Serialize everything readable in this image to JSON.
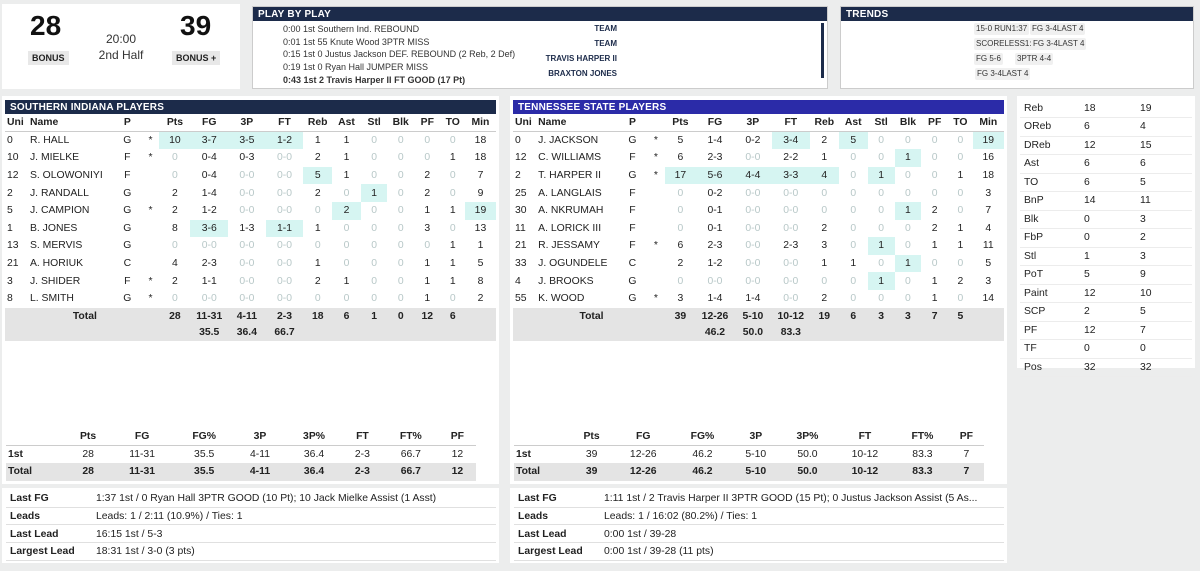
{
  "score": {
    "home_score": "28",
    "away_score": "39",
    "clock": "20:00",
    "period": "2nd Half",
    "home_bonus": "BONUS",
    "away_bonus": "BONUS  +"
  },
  "pbp": {
    "title": "PLAY BY PLAY",
    "events": [
      "0:00 1st Southern Ind. REBOUND",
      "0:01 1st 55 Knute Wood 3PTR MISS",
      "0:15 1st 0 Justus Jackson DEF. REBOUND (2 Reb, 2 Def)",
      "0:19 1st 0 Ryan Hall JUMPER MISS",
      "0:43 1st 2 Travis Harper II FT GOOD (17 Pt)"
    ]
  },
  "trends": {
    "title": "TRENDS",
    "rows": [
      {
        "label": "TEAM",
        "chips": [
          "15-0 RUN1:37",
          "FG 3-4LAST 4"
        ]
      },
      {
        "label": "TEAM",
        "chips": [
          "SCORELESS1:37",
          "FG 3-4LAST 4"
        ]
      },
      {
        "label": "TRAVIS HARPER II",
        "chips": [
          "FG 5-6",
          "3PTR 4-4"
        ]
      },
      {
        "label": "BRAXTON JONES",
        "chips": [
          "FG 3-4LAST 4"
        ]
      }
    ]
  },
  "home": {
    "title": "SOUTHERN INDIANA PLAYERS",
    "players": [
      {
        "uni": "0",
        "name": "R. HALL",
        "p": "G",
        "s": "*",
        "pts": "10",
        "fg": "3-7",
        "tp": "3-5",
        "ft": "1-2",
        "reb": "1",
        "ast": "1",
        "stl": "0",
        "blk": "0",
        "pf": "0",
        "to": "0",
        "min": "18"
      },
      {
        "uni": "10",
        "name": "J. MIELKE",
        "p": "F",
        "s": "*",
        "pts": "0",
        "fg": "0-4",
        "tp": "0-3",
        "ft": "0-0",
        "reb": "2",
        "ast": "1",
        "stl": "0",
        "blk": "0",
        "pf": "0",
        "to": "1",
        "min": "18"
      },
      {
        "uni": "12",
        "name": "S. OLOWONIYI",
        "p": "F",
        "s": "",
        "pts": "0",
        "fg": "0-4",
        "tp": "0-0",
        "ft": "0-0",
        "reb": "5",
        "ast": "1",
        "stl": "0",
        "blk": "0",
        "pf": "2",
        "to": "0",
        "min": "7"
      },
      {
        "uni": "2",
        "name": "J. RANDALL",
        "p": "G",
        "s": "",
        "pts": "2",
        "fg": "1-4",
        "tp": "0-0",
        "ft": "0-0",
        "reb": "2",
        "ast": "0",
        "stl": "1",
        "blk": "0",
        "pf": "2",
        "to": "0",
        "min": "9"
      },
      {
        "uni": "5",
        "name": "J. CAMPION",
        "p": "G",
        "s": "*",
        "pts": "2",
        "fg": "1-2",
        "tp": "0-0",
        "ft": "0-0",
        "reb": "0",
        "ast": "2",
        "stl": "0",
        "blk": "0",
        "pf": "1",
        "to": "1",
        "min": "19"
      },
      {
        "uni": "1",
        "name": "B. JONES",
        "p": "G",
        "s": "",
        "pts": "8",
        "fg": "3-6",
        "tp": "1-3",
        "ft": "1-1",
        "reb": "1",
        "ast": "0",
        "stl": "0",
        "blk": "0",
        "pf": "3",
        "to": "0",
        "min": "13"
      },
      {
        "uni": "13",
        "name": "S. MERVIS",
        "p": "G",
        "s": "",
        "pts": "0",
        "fg": "0-0",
        "tp": "0-0",
        "ft": "0-0",
        "reb": "0",
        "ast": "0",
        "stl": "0",
        "blk": "0",
        "pf": "0",
        "to": "1",
        "min": "1"
      },
      {
        "uni": "21",
        "name": "A. HORIUK",
        "p": "C",
        "s": "",
        "pts": "4",
        "fg": "2-3",
        "tp": "0-0",
        "ft": "0-0",
        "reb": "1",
        "ast": "0",
        "stl": "0",
        "blk": "0",
        "pf": "1",
        "to": "1",
        "min": "5"
      },
      {
        "uni": "3",
        "name": "J. SHIDER",
        "p": "F",
        "s": "*",
        "pts": "2",
        "fg": "1-1",
        "tp": "0-0",
        "ft": "0-0",
        "reb": "2",
        "ast": "1",
        "stl": "0",
        "blk": "0",
        "pf": "1",
        "to": "1",
        "min": "8"
      },
      {
        "uni": "8",
        "name": "L. SMITH",
        "p": "G",
        "s": "*",
        "pts": "0",
        "fg": "0-0",
        "tp": "0-0",
        "ft": "0-0",
        "reb": "0",
        "ast": "0",
        "stl": "0",
        "blk": "0",
        "pf": "1",
        "to": "0",
        "min": "2"
      }
    ],
    "total": {
      "label": "Total",
      "pts": "28",
      "fg": "11-31",
      "tp": "4-11",
      "ft": "2-3",
      "reb": "18",
      "ast": "6",
      "stl": "1",
      "blk": "0",
      "pf": "12",
      "to": "6"
    },
    "pct": {
      "fg": "35.5",
      "tp": "36.4",
      "ft": "66.7"
    },
    "halves": [
      {
        "label": "1st",
        "pts": "28",
        "fg": "11-31",
        "fgp": "35.5",
        "tp": "4-11",
        "tpp": "36.4",
        "ft": "2-3",
        "ftp": "66.7",
        "pf": "12"
      },
      {
        "label": "Total",
        "pts": "28",
        "fg": "11-31",
        "fgp": "35.5",
        "tp": "4-11",
        "tpp": "36.4",
        "ft": "2-3",
        "ftp": "66.7",
        "pf": "12"
      }
    ],
    "info": [
      {
        "k": "Last FG",
        "v": "1:37 1st / 0 Ryan Hall 3PTR GOOD (10 Pt); 10 Jack Mielke Assist (1 Asst)"
      },
      {
        "k": "Leads",
        "v": "Leads: 1 / 2:11 (10.9%) / Ties: 1"
      },
      {
        "k": "Last Lead",
        "v": "16:15 1st / 5-3"
      },
      {
        "k": "Largest Lead",
        "v": "18:31 1st / 3-0 (3 pts)"
      }
    ]
  },
  "away": {
    "title": "TENNESSEE STATE PLAYERS",
    "players": [
      {
        "uni": "0",
        "name": "J. JACKSON",
        "p": "G",
        "s": "*",
        "pts": "5",
        "fg": "1-4",
        "tp": "0-2",
        "ft": "3-4",
        "reb": "2",
        "ast": "5",
        "stl": "0",
        "blk": "0",
        "pf": "0",
        "to": "0",
        "min": "19"
      },
      {
        "uni": "12",
        "name": "C. WILLIAMS",
        "p": "F",
        "s": "*",
        "pts": "6",
        "fg": "2-3",
        "tp": "0-0",
        "ft": "2-2",
        "reb": "1",
        "ast": "0",
        "stl": "0",
        "blk": "1",
        "pf": "0",
        "to": "0",
        "min": "16"
      },
      {
        "uni": "2",
        "name": "T. HARPER II",
        "p": "G",
        "s": "*",
        "pts": "17",
        "fg": "5-6",
        "tp": "4-4",
        "ft": "3-3",
        "reb": "4",
        "ast": "0",
        "stl": "1",
        "blk": "0",
        "pf": "0",
        "to": "1",
        "min": "18"
      },
      {
        "uni": "25",
        "name": "A. LANGLAIS",
        "p": "F",
        "s": "",
        "pts": "0",
        "fg": "0-2",
        "tp": "0-0",
        "ft": "0-0",
        "reb": "0",
        "ast": "0",
        "stl": "0",
        "blk": "0",
        "pf": "0",
        "to": "0",
        "min": "3"
      },
      {
        "uni": "30",
        "name": "A. NKRUMAH",
        "p": "F",
        "s": "",
        "pts": "0",
        "fg": "0-1",
        "tp": "0-0",
        "ft": "0-0",
        "reb": "0",
        "ast": "0",
        "stl": "0",
        "blk": "1",
        "pf": "2",
        "to": "0",
        "min": "7"
      },
      {
        "uni": "11",
        "name": "A. LORICK III",
        "p": "F",
        "s": "",
        "pts": "0",
        "fg": "0-1",
        "tp": "0-0",
        "ft": "0-0",
        "reb": "2",
        "ast": "0",
        "stl": "0",
        "blk": "0",
        "pf": "2",
        "to": "1",
        "min": "4"
      },
      {
        "uni": "21",
        "name": "R. JESSAMY",
        "p": "F",
        "s": "*",
        "pts": "6",
        "fg": "2-3",
        "tp": "0-0",
        "ft": "2-3",
        "reb": "3",
        "ast": "0",
        "stl": "1",
        "blk": "0",
        "pf": "1",
        "to": "1",
        "min": "11"
      },
      {
        "uni": "33",
        "name": "J. OGUNDELE",
        "p": "C",
        "s": "",
        "pts": "2",
        "fg": "1-2",
        "tp": "0-0",
        "ft": "0-0",
        "reb": "1",
        "ast": "1",
        "stl": "0",
        "blk": "1",
        "pf": "0",
        "to": "0",
        "min": "5"
      },
      {
        "uni": "4",
        "name": "J. BROOKS",
        "p": "G",
        "s": "",
        "pts": "0",
        "fg": "0-0",
        "tp": "0-0",
        "ft": "0-0",
        "reb": "0",
        "ast": "0",
        "stl": "1",
        "blk": "0",
        "pf": "1",
        "to": "2",
        "min": "3"
      },
      {
        "uni": "55",
        "name": "K. WOOD",
        "p": "G",
        "s": "*",
        "pts": "3",
        "fg": "1-4",
        "tp": "1-4",
        "ft": "0-0",
        "reb": "2",
        "ast": "0",
        "stl": "0",
        "blk": "0",
        "pf": "1",
        "to": "0",
        "min": "14"
      }
    ],
    "total": {
      "label": "Total",
      "pts": "39",
      "fg": "12-26",
      "tp": "5-10",
      "ft": "10-12",
      "reb": "19",
      "ast": "6",
      "stl": "3",
      "blk": "3",
      "pf": "7",
      "to": "5"
    },
    "pct": {
      "fg": "46.2",
      "tp": "50.0",
      "ft": "83.3"
    },
    "halves": [
      {
        "label": "1st",
        "pts": "39",
        "fg": "12-26",
        "fgp": "46.2",
        "tp": "5-10",
        "tpp": "50.0",
        "ft": "10-12",
        "ftp": "83.3",
        "pf": "7"
      },
      {
        "label": "Total",
        "pts": "39",
        "fg": "12-26",
        "fgp": "46.2",
        "tp": "5-10",
        "tpp": "50.0",
        "ft": "10-12",
        "ftp": "83.3",
        "pf": "7"
      }
    ],
    "info": [
      {
        "k": "Last FG",
        "v": "1:11 1st / 2 Travis Harper II 3PTR GOOD (15 Pt); 0 Justus Jackson Assist (5 As..."
      },
      {
        "k": "Leads",
        "v": "Leads: 1 / 16:02 (80.2%) / Ties: 1"
      },
      {
        "k": "Last Lead",
        "v": "0:00 1st / 39-28"
      },
      {
        "k": "Largest Lead",
        "v": "0:00 1st / 39-28 (11 pts)"
      }
    ]
  },
  "box_headers": [
    "Uni",
    "Name",
    "P",
    "",
    "Pts",
    "FG",
    "3P",
    "FT",
    "Reb",
    "Ast",
    "Stl",
    "Blk",
    "PF",
    "TO",
    "Min"
  ],
  "half_headers": [
    "",
    "Pts",
    "FG",
    "FG%",
    "3P",
    "3P%",
    "FT",
    "FT%",
    "PF"
  ],
  "team_stats": [
    {
      "k": "Reb",
      "h": "18",
      "a": "19"
    },
    {
      "k": "OReb",
      "h": "6",
      "a": "4"
    },
    {
      "k": "DReb",
      "h": "12",
      "a": "15"
    },
    {
      "k": "Ast",
      "h": "6",
      "a": "6"
    },
    {
      "k": "TO",
      "h": "6",
      "a": "5"
    },
    {
      "k": "BnP",
      "h": "14",
      "a": "11"
    },
    {
      "k": "Blk",
      "h": "0",
      "a": "3"
    },
    {
      "k": "FbP",
      "h": "0",
      "a": "2"
    },
    {
      "k": "Stl",
      "h": "1",
      "a": "3"
    },
    {
      "k": "PoT",
      "h": "5",
      "a": "9"
    },
    {
      "k": "Paint",
      "h": "12",
      "a": "10"
    },
    {
      "k": "SCP",
      "h": "2",
      "a": "5"
    },
    {
      "k": "PF",
      "h": "12",
      "a": "7"
    },
    {
      "k": "TF",
      "h": "0",
      "a": "0"
    },
    {
      "k": "Pos",
      "h": "32",
      "a": "32"
    }
  ],
  "colors": {
    "header_home": "#1c2b4a",
    "header_away": "#2b2ba8",
    "highlight": "#d6f5f2",
    "total_bg": "#e4e4e4"
  }
}
